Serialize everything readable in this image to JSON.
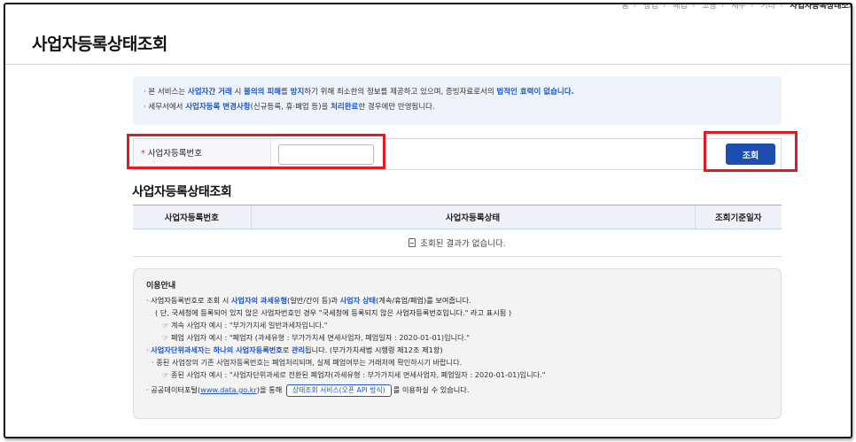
{
  "breadcrumb": [
    "홈",
    "창업",
    "폐업",
    "고용",
    "세무",
    "기타",
    "사업자등록상태조회"
  ],
  "page_title": "사업자등록상태조회",
  "notice": {
    "line1": {
      "prefix": "본 서비스는 ",
      "hl1": "사업자간 거래",
      "t1": " 시 ",
      "hl2": "불의의 피해",
      "t2": "를 ",
      "hl3": "방지",
      "t3": "하기 위해 최소한의 정보를 제공하고 있으며, 증빙자료로서의 ",
      "hl4": "법적인 효력이 없습니다."
    },
    "line2": {
      "prefix": "세무서에서 ",
      "hl1": "사업자등록 변경사항",
      "t1": "(신규등록, 휴·폐업 등)을 ",
      "hl2": "처리완료",
      "t2": "한 경우에만 반영됩니다."
    }
  },
  "search": {
    "required_mark": "*",
    "label": "사업자등록번호",
    "input_value": "",
    "button_label": "조회"
  },
  "results": {
    "section_title": "사업자등록상태조회",
    "columns": [
      "사업자등록번호",
      "사업자등록상태",
      "조회기준일자"
    ],
    "empty_message": "조회된 결과가 없습니다."
  },
  "guide": {
    "title": "이용안내",
    "p1": {
      "t0": "사업자등록번호로 조회 시 ",
      "hl1": "사업자의 과세유형",
      "t1": "(일반/간이 등)과 ",
      "hl2": "사업자 상태",
      "t2": "(계속/휴업/폐업)를 보여줍니다."
    },
    "p1_note": "( 단, 국세청에 등록되어 있지 않은 사업자번호인 경우 \"국세청에 등록되지 않은 사업자등록번호입니다.\" 라고 표시됨 )",
    "p1_ex1": "☞ 계속 사업자 예시 : \"부가가치세 일반과세자입니다.\"",
    "p1_ex2": "☞ 폐업 사업자 예시 : \"폐업자 (과세유형 : 부가가치세 면세사업자, 폐업일자 : 2020-01-01)입니다.\"",
    "p2": {
      "hl1": "사업자단위과세자",
      "t1": "는 ",
      "hl2": "하나의 사업자등록번호",
      "t2": "로 ",
      "hl3": "관리",
      "t3": "됩니다. (부가가치세법 시행령 제12조 제1항)"
    },
    "p2_note": "· 종된 사업장의 기존 사업자등록번호는 폐업처리되며, 실제 폐업여부는 거래처에 확인하시기 바랍니다.",
    "p2_ex": "☞ 종된 사업자 예시 : \"사업자단위과세로 전환된 폐업자(과세유형 : 부가가치세 면세사업자, 폐업일자 : 2020-01-01)입니다.\"",
    "p3": {
      "t0": "공공데이터포털(",
      "link": "www.data.go.kr",
      "t1": ")을 통해",
      "api_button": "상태조회 서비스(오픈 API 방식)",
      "t2": "를 이용하실 수 있습니다."
    }
  },
  "colors": {
    "accent": "#1e4fb0",
    "highlight_text": "#1f56c2",
    "annotation_red": "#e01b24",
    "notice_bg": "#eef3fa"
  }
}
